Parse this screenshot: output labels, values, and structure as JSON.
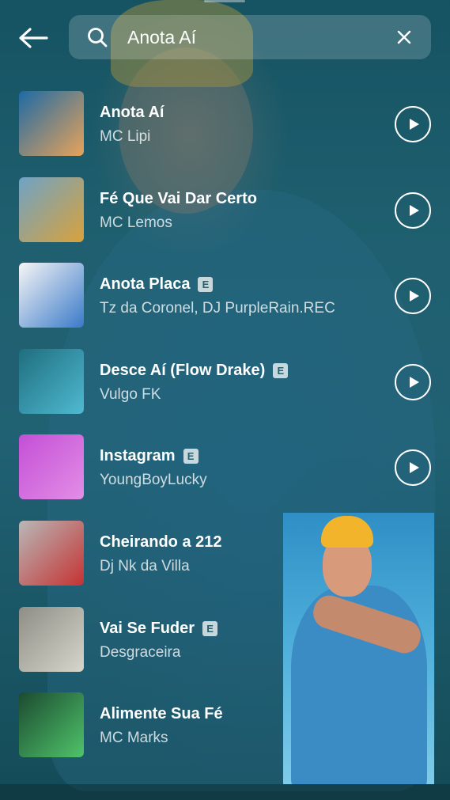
{
  "search": {
    "query": "Anota Aí"
  },
  "icons": {
    "back": "back-arrow-icon",
    "search": "search-icon",
    "clear": "close-icon",
    "play": "play-icon"
  },
  "colors": {
    "background": "#1d5d6e",
    "text_primary": "#ffffff",
    "text_secondary": "#c4d8dd"
  },
  "results": [
    {
      "title": "Anota Aí",
      "artist": "MC Lipi",
      "explicit": false,
      "cover_colors": [
        "#1d6aa5",
        "#e8a35a"
      ]
    },
    {
      "title": "Fé Que Vai Dar Certo",
      "artist": "MC Lemos",
      "explicit": false,
      "cover_colors": [
        "#6ea3c6",
        "#d9a23b"
      ]
    },
    {
      "title": "Anota Placa",
      "artist": "Tz da Coronel, DJ PurpleRain.REC",
      "explicit": true,
      "explicit_label": "E",
      "cover_colors": [
        "#f6f6f6",
        "#3a7ac9"
      ]
    },
    {
      "title": "Desce Aí (Flow Drake)",
      "artist": "Vulgo FK",
      "explicit": true,
      "explicit_label": "E",
      "cover_colors": [
        "#1f6e7e",
        "#4fbad1"
      ]
    },
    {
      "title": "Instagram",
      "artist": "YoungBoyLucky",
      "explicit": true,
      "explicit_label": "E",
      "cover_colors": [
        "#c44fd6",
        "#e28ee6"
      ]
    },
    {
      "title": "Cheirando a 212",
      "artist": "Dj Nk da Villa",
      "explicit": false,
      "cover_colors": [
        "#b8b8b8",
        "#c63232"
      ]
    },
    {
      "title": "Vai Se Fuder",
      "artist": "Desgraceira",
      "explicit": true,
      "explicit_label": "E",
      "cover_colors": [
        "#8e8e86",
        "#d6d6cc"
      ]
    },
    {
      "title": "Alimente Sua Fé",
      "artist": "MC Marks",
      "explicit": false,
      "cover_colors": [
        "#1c4a30",
        "#4fc46a"
      ]
    }
  ]
}
